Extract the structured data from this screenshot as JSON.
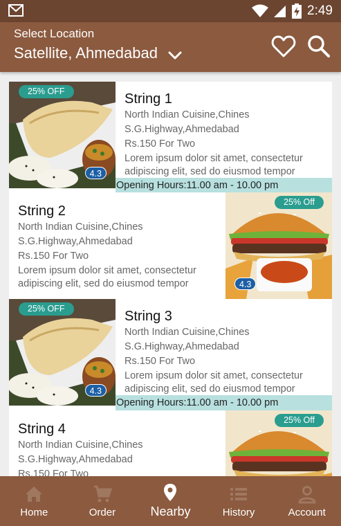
{
  "status_bar": {
    "time": "2:49",
    "icons": [
      "gmail-icon",
      "wifi-icon",
      "signal-icon",
      "battery-charging-icon"
    ]
  },
  "app_bar": {
    "location_label": "Select Location",
    "location_value": "Satellite, Ahmedabad",
    "icons": [
      "chevron-down-icon",
      "heart-icon",
      "search-icon"
    ]
  },
  "restaurants": [
    {
      "name": "String 1",
      "cuisine": "North Indian Cuisine,Chines",
      "address": "S.G.Highway,Ahmedabad",
      "price": "Rs.150 For Two",
      "desc_line1": "Lorem ipsum dolor sit amet, consectetur",
      "desc_line2": "adipiscing elit, sed do eiusmod tempor",
      "hours": "Opening Hours:11.00 am - 10.00 pm",
      "discount": "25% OFF",
      "rating": "4.3",
      "image": "dosa-image"
    },
    {
      "name": "String 2",
      "cuisine": "North Indian Cuisine,Chines",
      "address": "S.G.Highway,Ahmedabad",
      "price": "Rs.150 For Two",
      "desc_line1": "Lorem ipsum dolor sit amet, consectetur",
      "desc_line2": "adipiscing elit, sed do eiusmod tempor",
      "discount": "25% Off",
      "rating": "4.3",
      "image": "burger-image"
    },
    {
      "name": "String 3",
      "cuisine": "North Indian Cuisine,Chines",
      "address": "S.G.Highway,Ahmedabad",
      "price": "Rs.150 For Two",
      "desc_line1": "Lorem ipsum dolor sit amet, consectetur",
      "desc_line2": "adipiscing elit, sed do eiusmod tempor",
      "hours": "Opening Hours:11.00 am - 10.00 pm",
      "discount": "25% OFF",
      "rating": "4.3",
      "image": "dosa-image"
    },
    {
      "name": "String 4",
      "cuisine": "North Indian Cuisine,Chines",
      "address": "S.G.Highway,Ahmedabad",
      "price": "Rs.150 For Two",
      "discount": "25% Off",
      "image": "burger-image"
    }
  ],
  "bottom_nav": {
    "active": "Nearby",
    "items": [
      {
        "label": "Home",
        "icon": "home-icon"
      },
      {
        "label": "Order",
        "icon": "cart-icon"
      },
      {
        "label": "Nearby",
        "icon": "location-pin-icon"
      },
      {
        "label": "History",
        "icon": "list-icon"
      },
      {
        "label": "Account",
        "icon": "person-icon"
      }
    ]
  },
  "colors": {
    "status_bar": "#6b4530",
    "app_bar": "#8b5a3f",
    "discount_badge": "#2a9d8f",
    "rating_badge": "#1c5fa5",
    "hours_strip": "#b7e0df",
    "nav_inactive_icon": "#a07860"
  }
}
